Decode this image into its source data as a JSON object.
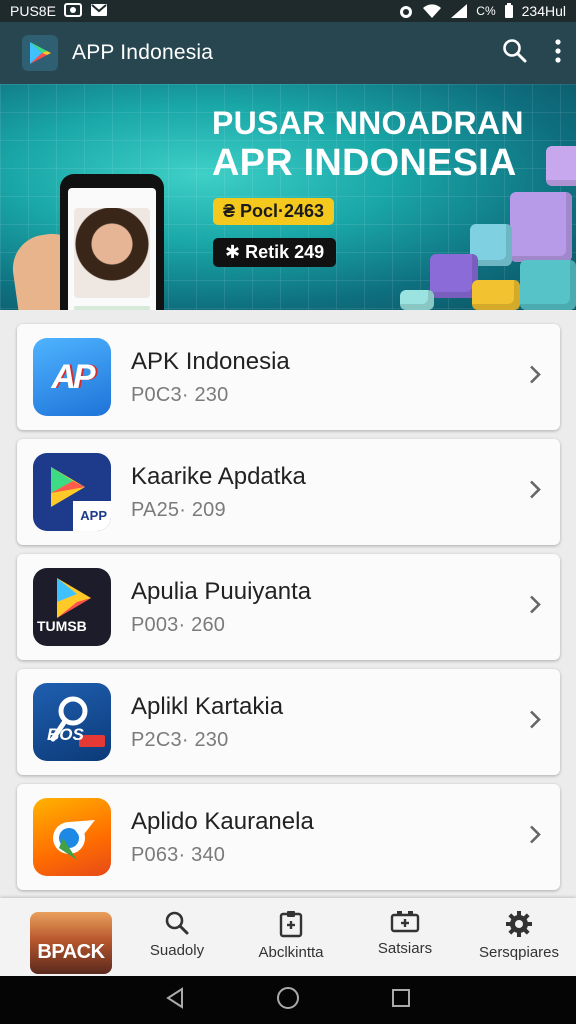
{
  "status_bar": {
    "left_text": "PUS8E",
    "battery": "C%",
    "time": "234Hul"
  },
  "app_bar": {
    "title": "APP Indonesia"
  },
  "banner": {
    "title_line1": "PUSAR NNOADRAN",
    "title_line2": "APR INDONESIA",
    "badge_yellow": "₴ Pocl·2463",
    "badge_dark": "✱ Retik 249"
  },
  "apps": [
    {
      "name": "APK Indonesia",
      "code": "P0C3· 230",
      "icon_label": "AP",
      "icon": "ap-logo-icon"
    },
    {
      "name": "Kaarike Apdatka",
      "code": "PA25· 209",
      "icon_label": "APP",
      "icon": "play-app-icon"
    },
    {
      "name": "Apulia Puuiyanta",
      "code": "P003· 260",
      "icon_label": "TUMSB",
      "icon": "play-tumsb-icon"
    },
    {
      "name": "Aplikl Kartakia",
      "code": "P2C3· 230",
      "icon_label": "BOS",
      "icon": "bos-icon"
    },
    {
      "name": "Aplido Kauranela",
      "code": "P063· 340",
      "icon_label": "",
      "icon": "chrome-like-icon"
    }
  ],
  "bottom_nav": {
    "thumb_label": "BPACK",
    "items": [
      {
        "label": "Suadoly",
        "icon": "search-icon"
      },
      {
        "label": "Abclkintta",
        "icon": "clipboard-icon"
      },
      {
        "label": "Satsiars",
        "icon": "battery-plus-icon"
      },
      {
        "label": "Sersqpiares",
        "icon": "gear-icon"
      }
    ]
  },
  "colors": {
    "app_bar": "#274650",
    "banner_teal": "#1aa8a8",
    "badge_yellow": "#f5c81e"
  }
}
